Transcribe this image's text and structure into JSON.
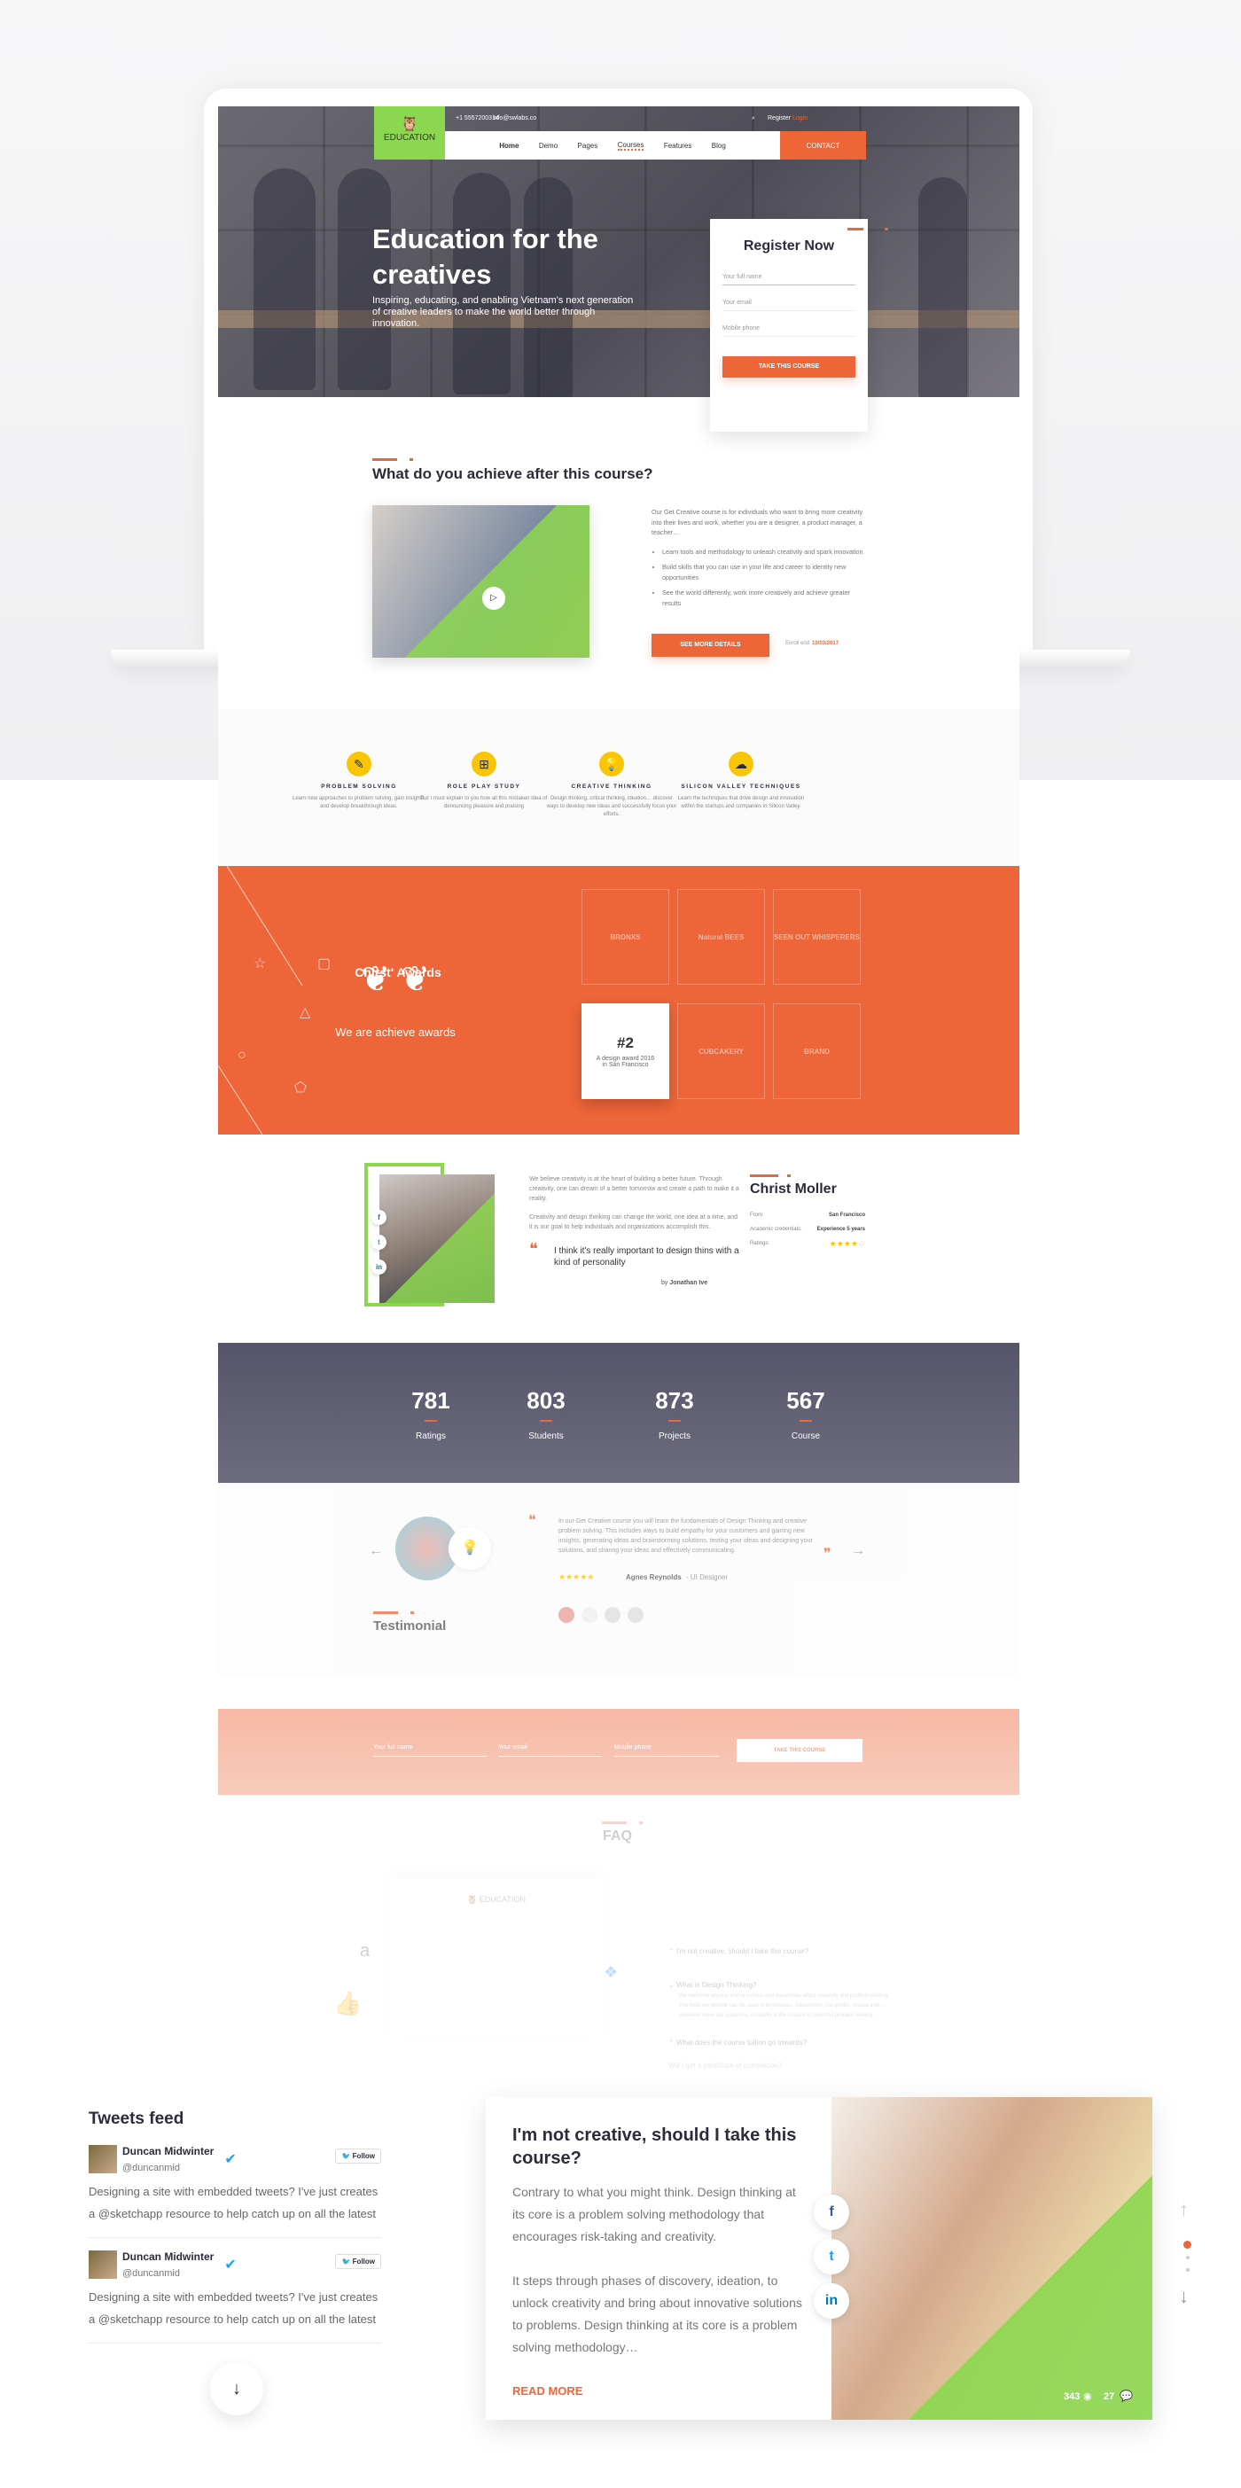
{
  "header": {
    "logo": "EDUCATION",
    "phone": "+1 5557200314",
    "email": "info@swlabs.co",
    "register": "Register",
    "login": "Login",
    "nav": [
      "Home",
      "Demo",
      "Pages",
      "Courses",
      "Features",
      "Blog"
    ],
    "active_nav": "Courses",
    "contact": "CONTACT"
  },
  "hero": {
    "title": "Education for the creatives",
    "subtitle": "Inspiring, educating, and enabling Vietnam's next generation of creative leaders to make the world better through innovation."
  },
  "register": {
    "title": "Register Now",
    "name_ph": "Your full name",
    "email_ph": "Your email",
    "phone_ph": "Mobile phone",
    "button": "TAKE THIS COURSE"
  },
  "achieve": {
    "title": "What do you achieve after this course?",
    "intro": "Our Get Creative course is for individuals who want to bring more creativity into their lives and work, whether you are a designer, a product manager, a teacher…",
    "bullets": [
      "Learn tools and methodology to unleash creativity and spark innovation",
      "Build skills that you can use in your life and career to identity new opportunities",
      "See the world differently, work more creatively and achieve greater results"
    ],
    "button": "SEE MORE DETAILS",
    "enroll_label": "Enroll end",
    "enroll_date": "10/03/2017"
  },
  "features": [
    {
      "icon": "pencil-icon",
      "title": "PROBLEM SOLVING",
      "desc": "Learn new approaches to problem solving, gain insights, and develop breakthrough ideas."
    },
    {
      "icon": "gamepad-icon",
      "title": "ROLE PLAY STUDY",
      "desc": "But I must explain to you how all this mistaken idea of denouncing pleasure and praising"
    },
    {
      "icon": "lightbulb-icon",
      "title": "CREATIVE THINKING",
      "desc": "Design thinking, critical thinking, ideation… discover ways to develop new ideas and successfully focus your efforts."
    },
    {
      "icon": "cloud-upload-icon",
      "title": "SILICON VALLEY TECHNIQUES",
      "desc": "Learn the techniques that drive design and innovation within the startups and companies in Silicon Valley."
    }
  ],
  "awards": {
    "title": "Chirst' Awards",
    "subtitle": "We are achieve awards",
    "badges": [
      "BRONXS",
      "Natural BEES",
      "SEEN OUT WHISPERERS",
      "CUBCAKERY",
      "BRAND"
    ],
    "featured_rank": "#2",
    "featured_desc": "A design award 2016 in San Francisco"
  },
  "profile": {
    "bio1": "We believe creativity is at the heart of building a better future.  Through creativity, one can dream of a better tomorrow and create a path to make it a reality.",
    "bio2": "Creativity and design thinking can change the world, one idea at a time, and it is our goal to help individuals and organizations accomplish this.",
    "quote": "I think it's really important to design thins with a kind of personality",
    "by": "by",
    "author": "Jonathan Ive",
    "name": "Christ Moller",
    "from_label": "From:",
    "from": "San Francisco",
    "cred_label": "Academic credentials:",
    "cred": "Experience 5 years",
    "ratings_label": "Ratings:",
    "rating": 4,
    "rating_max": 5
  },
  "stats": [
    {
      "value": "781",
      "label": "Ratings"
    },
    {
      "value": "803",
      "label": "Students"
    },
    {
      "value": "873",
      "label": "Projects"
    },
    {
      "value": "567",
      "label": "Course"
    }
  ],
  "testimonial": {
    "heading": "Testimonial",
    "text": "In our Get Creative course you will learn the fundamentals of Design Thinking and creative problem solving. This includes ways to build empathy for your customers and gaining new insights, generating ideas and brainstorming solutions, testing your ideas and designing your solutions, and sharing your ideas and effectively communicating.",
    "rating": 5,
    "name": "Agnes Reynolds",
    "role": "- UI Designer"
  },
  "form": {
    "name_ph": "Your full name",
    "email_ph": "Your email",
    "phone_ph": "Mobile phone",
    "button": "TAKE THIS COURSE"
  },
  "faq": {
    "title": "FAQ",
    "logo": "EDUCATION",
    "questions": [
      "I'm not creative, should I take this course?",
      "What is Design Thinking?",
      "What does the course tuition go towards?",
      "Will I get a certificate of completion?"
    ],
    "answer": "We welcome anyone who is curious and passionate about creativity and problem solving. The tools we provide can be used in businesses, classrooms, non-profits, restaurants… wherever there are questions, creativity is the solution to powerful problem solving."
  },
  "tweets": {
    "title": "Tweets feed",
    "items": [
      {
        "name": "Duncan Midwinter",
        "handle": "@duncanmid",
        "follow": "Follow",
        "text": "Designing a site with embedded tweets? I've just creates a @sketchapp resource to help catch up on all the latest"
      },
      {
        "name": "Duncan Midwinter",
        "handle": "@duncanmid",
        "follow": "Follow",
        "text": "Designing a site with embedded tweets? I've just creates a @sketchapp resource to help catch up on all the latest"
      }
    ]
  },
  "card": {
    "title": "I'm not creative, should I take this course?",
    "p1": "Contrary to what you might think. Design thinking at its core is a problem solving methodology that encourages risk-taking and creativity.",
    "p2": "It steps through phases of discovery, ideation, to unlock creativity and bring about innovative solutions to problems. Design thinking at its core is a problem solving methodology…",
    "read_more": "READ MORE",
    "views": "343",
    "comments": "27"
  },
  "colors": {
    "accent": "#ee6537",
    "green": "#8cd750",
    "yellow": "#f9c507",
    "dark": "#2b2b3c"
  }
}
